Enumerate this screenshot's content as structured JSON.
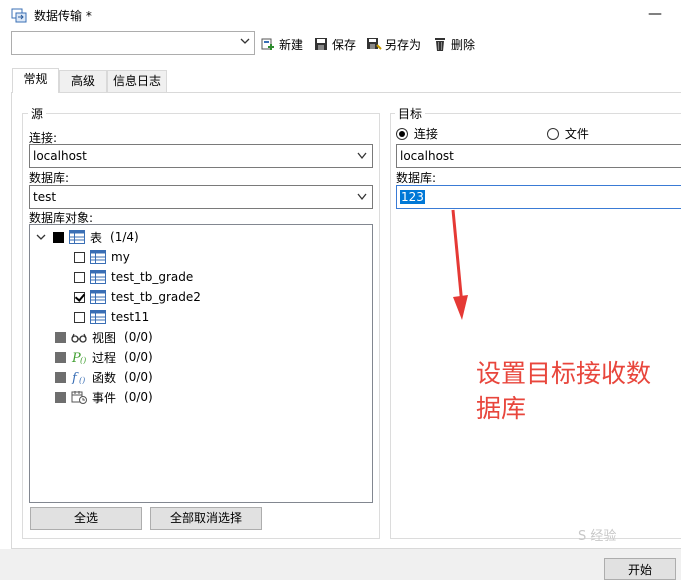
{
  "window": {
    "title": "数据传输 *",
    "minimize_glyph": "—"
  },
  "toolbar": {
    "profile_value": "",
    "new_label": "新建",
    "save_label": "保存",
    "save_as_label": "另存为",
    "delete_label": "删除"
  },
  "tabs": [
    {
      "label": "常规"
    },
    {
      "label": "高级"
    },
    {
      "label": "信息日志"
    }
  ],
  "source": {
    "group_title": "源",
    "connection_label": "连接:",
    "connection_value": "localhost",
    "database_label": "数据库:",
    "database_value": "test",
    "objects_label": "数据库对象:",
    "tree": {
      "tables_label": "表",
      "tables_count": "(1/4)",
      "tables": [
        "my",
        "test_tb_grade",
        "test_tb_grade2",
        "test11"
      ],
      "views_label": "视图",
      "views_count": "(0/0)",
      "procedures_label": "过程",
      "procedures_count": "(0/0)",
      "functions_label": "函数",
      "functions_count": "(0/0)",
      "events_label": "事件",
      "events_count": "(0/0)"
    },
    "select_all_label": "全选",
    "deselect_all_label": "全部取消选择"
  },
  "target": {
    "group_title": "目标",
    "radio_connection_label": "连接",
    "radio_file_label": "文件",
    "connection_value": "localhost",
    "database_label": "数据库:",
    "database_value": "123"
  },
  "annotation": {
    "line1": "设置目标接收数",
    "line2": "据库"
  },
  "footer": {
    "start_label": "开始"
  },
  "watermark": "S 经验"
}
